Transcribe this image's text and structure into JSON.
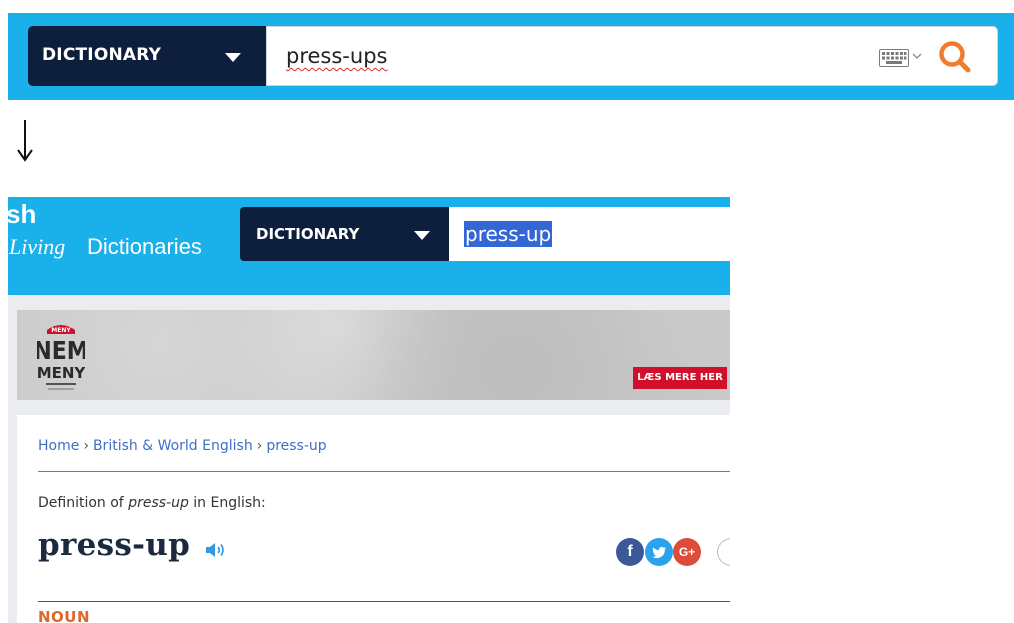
{
  "top_search": {
    "dropdown_label": "DICTIONARY",
    "query": "press-ups"
  },
  "page": {
    "logo": {
      "partial_text": "sh",
      "living": "Living",
      "dictionaries": "Dictionaries"
    },
    "search": {
      "dropdown_label": "DICTIONARY",
      "query": "press-up"
    },
    "ad": {
      "brand_top": "MENY",
      "brand_main": "NEM",
      "brand_sub": "MENY",
      "cta": "LÆS MERE HER"
    },
    "breadcrumb": {
      "home": "Home",
      "sep1": "›",
      "section": "British & World English",
      "sep2": "›",
      "current": "press-up"
    },
    "definition_line": {
      "prefix": "Definition of ",
      "word": "press-up",
      "suffix": " in English:"
    },
    "headword": "press-up",
    "share": {
      "facebook": "f",
      "googleplus": "G+"
    },
    "part_of_speech": "NOUN"
  },
  "colors": {
    "header_blue": "#1ab0ea",
    "navy": "#0e1f3e",
    "search_orange": "#ef7d2d",
    "link_blue": "#3f6fc7",
    "noun_orange": "#e0662a"
  },
  "icons": [
    "keyboard-icon",
    "chevron-down-icon",
    "search-icon",
    "down-arrow-icon",
    "audio-icon",
    "facebook-icon",
    "twitter-icon",
    "googleplus-icon"
  ]
}
